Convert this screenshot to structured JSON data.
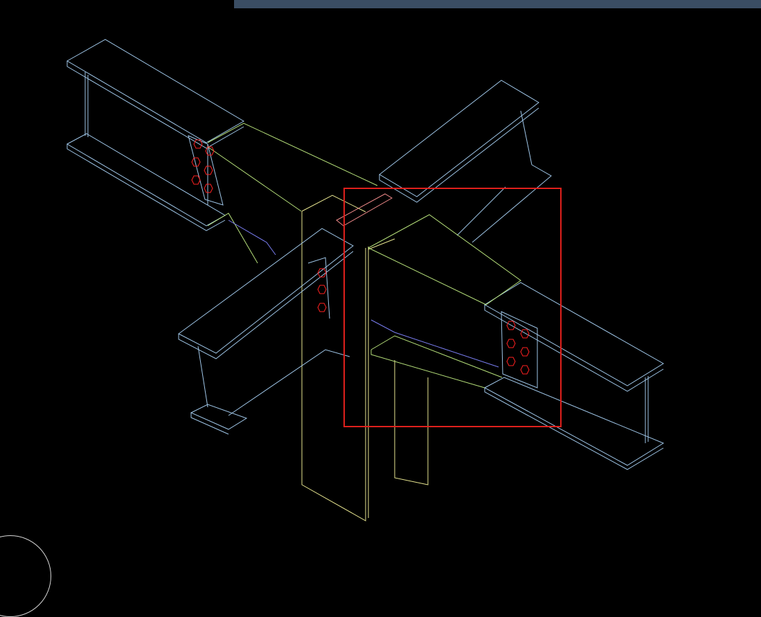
{
  "banner": {
    "text": ""
  },
  "colors": {
    "background": "#000000",
    "beam_edge": "#9fc6e8",
    "column_edge": "#e8e690",
    "haunch_edge": "#b6e07a",
    "web_edge": "#7a7ef2",
    "bolt": "#ff2020",
    "selection": "#e0201c",
    "plate_highlight": "#f08a8a"
  },
  "icons": {
    "bolt": "hexagon-bolt-icon",
    "orbit": "orbit-circle-icon"
  }
}
